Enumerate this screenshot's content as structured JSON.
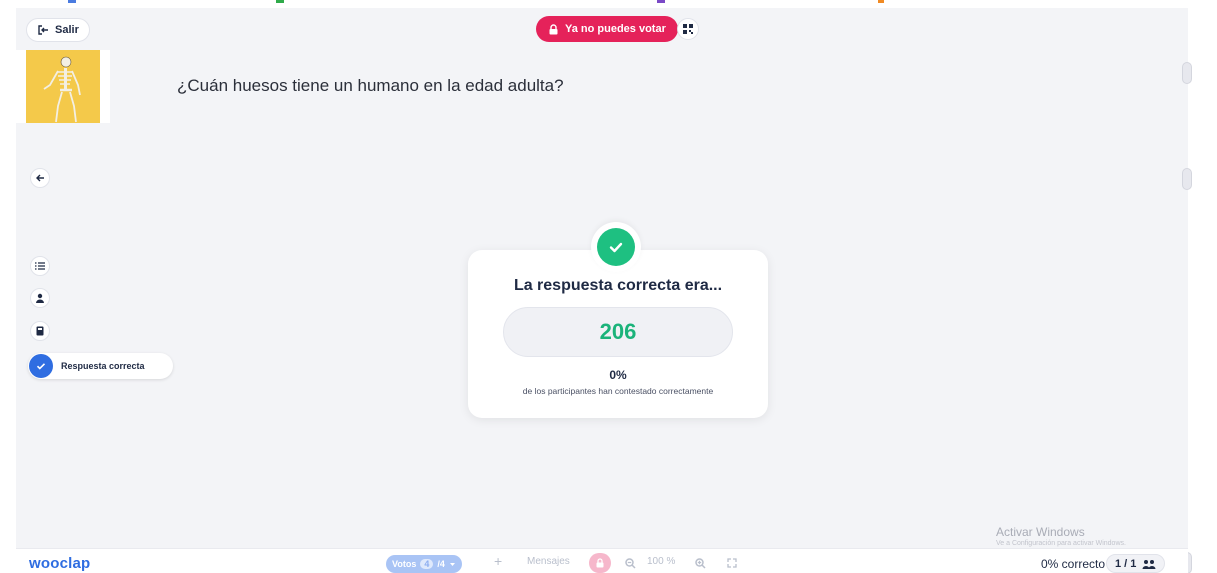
{
  "header": {
    "exit_label": "Salir",
    "vote_status": "Ya no puedes votar"
  },
  "question": {
    "text": "¿Cuán huesos tiene un humano en la edad adulta?"
  },
  "sidebar": {
    "correct_answer_label": "Respuesta correcta"
  },
  "result_card": {
    "title": "La respuesta correcta era...",
    "answer": "206",
    "percent": "0%",
    "caption": "de los participantes han contestado correctamente"
  },
  "bottom_bar": {
    "logo": "wooclap",
    "votes_label": "Votos",
    "votes_current": "4",
    "votes_total": "/4",
    "messages_label": "Mensajes",
    "zoom": "100 %",
    "correct_summary": "0% correcto",
    "slide_counter": "1 / 1"
  },
  "watermark": {
    "title": "Activar Windows",
    "subtitle": "Ve a Configuración para activar Windows."
  },
  "colors": {
    "accent_blue": "#2f6de1",
    "danger_pink": "#e5225a",
    "success_green": "#1ec081"
  },
  "icons": [
    "exit-icon",
    "lock-icon",
    "qr-code-icon",
    "arrow-left-icon",
    "list-icon",
    "user-icon",
    "calculator-icon",
    "check-icon",
    "plus-icon",
    "zoom-out-icon",
    "zoom-in-icon",
    "fullscreen-icon",
    "participants-icon"
  ]
}
